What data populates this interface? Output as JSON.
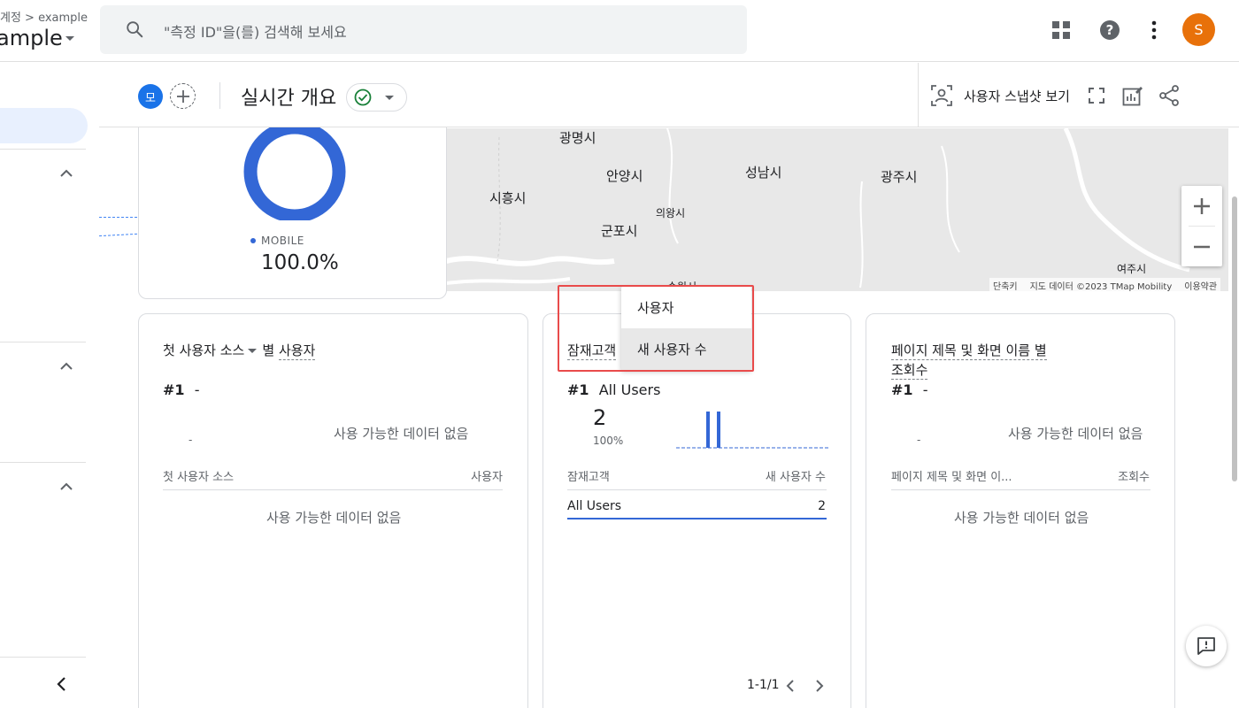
{
  "header": {
    "breadcrumb": "계정 > example",
    "account_name": "ample",
    "search_placeholder": "\"측정 ID\"을(를) 검색해 보세요",
    "avatar_letter": "S"
  },
  "subheader": {
    "segment_chip": "모",
    "title": "실시간 개요",
    "snapshot_label": "사용자 스냅샷 보기"
  },
  "map": {
    "labels": [
      "광명시",
      "안양시",
      "성남시",
      "광주시",
      "시흥시",
      "의왕시",
      "군포시",
      "여주시",
      "수원시"
    ],
    "attribution": {
      "shortcuts": "단축키",
      "data": "지도 데이터 ©2023 TMap Mobility",
      "terms": "이용약관"
    }
  },
  "device_card": {
    "legend_label": "MOBILE",
    "legend_value": "100.0%",
    "share_mobile": 1.0
  },
  "card_source": {
    "title_dim": "첫 사용자 소스",
    "title_suffix": "별",
    "title_metric": "사용자",
    "rank": "#1",
    "rank_value": "-",
    "chart_dash": "-",
    "nodata": "사용 가능한 데이터 없음",
    "col_dim": "첫 사용자 소스",
    "col_metric": "사용자",
    "table_nodata": "사용 가능한 데이터 없음"
  },
  "card_audience": {
    "title_dim": "잠재고객",
    "rank": "#1",
    "rank_value": "All Users",
    "big_value": "2",
    "big_pct": "100%",
    "col_dim": "잠재고객",
    "col_metric": "새 사용자 수",
    "row_label": "All Users",
    "row_value": "2",
    "pager": "1-1/1"
  },
  "card_pages": {
    "title_line1": "페이지 제목 및 화면 이름 별",
    "title_line2": "조회수",
    "rank": "#1",
    "rank_value": "-",
    "chart_dash": "-",
    "nodata": "사용 가능한 데이터 없음",
    "col_dim": "페이지 제목 및 화면 이...",
    "col_metric": "조회수",
    "table_nodata": "사용 가능한 데이터 없음"
  },
  "menu": {
    "items": [
      "사용자",
      "새 사용자 수"
    ],
    "hovered_index": 1
  },
  "colors": {
    "accent": "#1a73e8",
    "chart_blue": "#3367d6",
    "avatar": "#e8710a",
    "highlight": "#e94b4b"
  }
}
